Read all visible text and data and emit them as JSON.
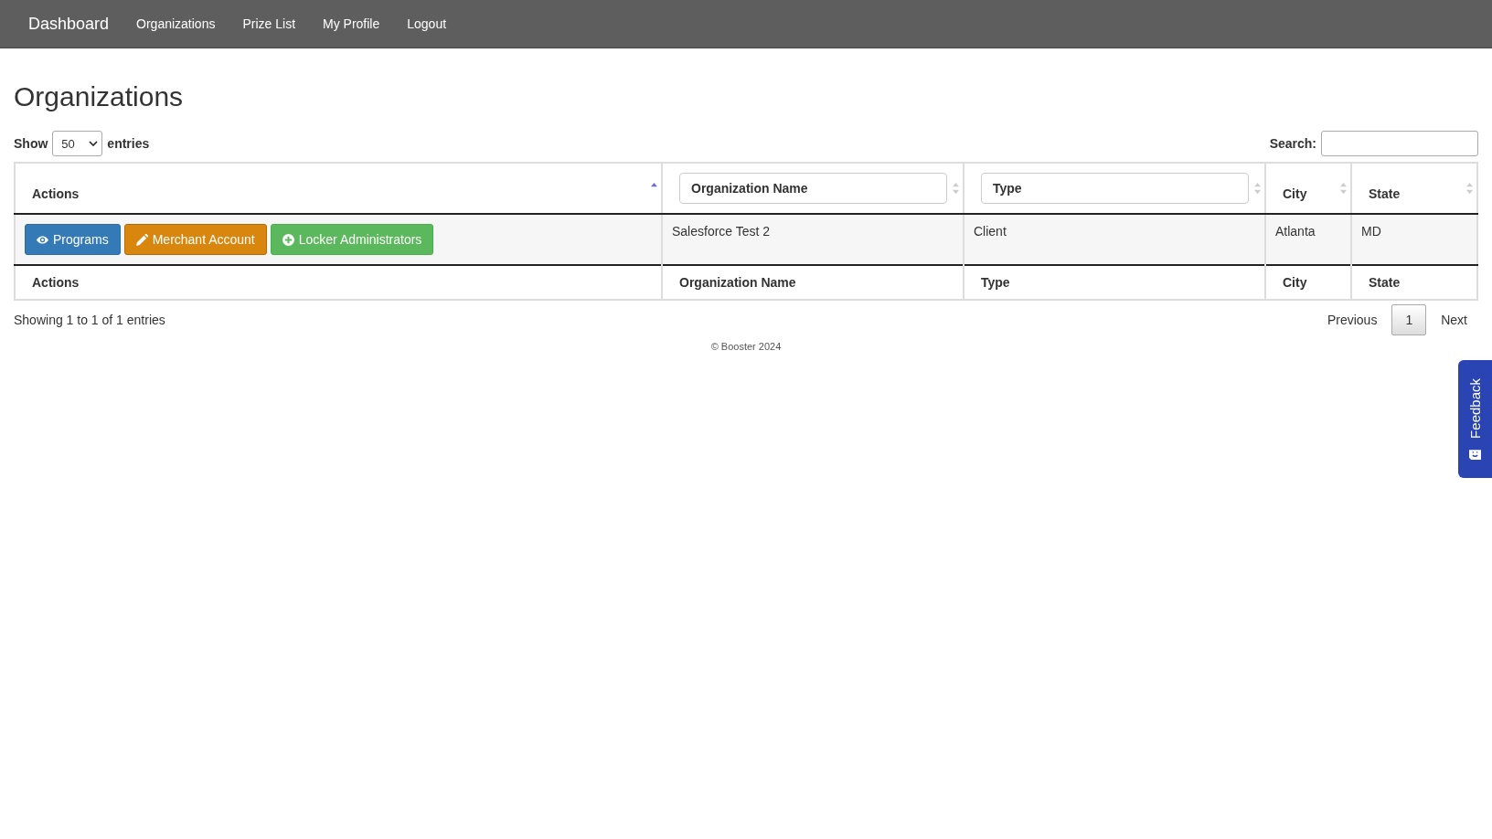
{
  "navbar": {
    "brand": "Dashboard",
    "links": [
      {
        "label": "Organizations"
      },
      {
        "label": "Prize List"
      },
      {
        "label": "My Profile"
      },
      {
        "label": "Logout"
      }
    ]
  },
  "page_title": "Organizations",
  "length_menu": {
    "label_before": "Show",
    "value": "50",
    "label_after": "entries"
  },
  "search": {
    "label": "Search:"
  },
  "table": {
    "columns": [
      {
        "label": "Actions",
        "kind": "text",
        "sorted": true
      },
      {
        "placeholder": "Organization Name",
        "kind": "filter",
        "sorted": false
      },
      {
        "placeholder": "Type",
        "kind": "filter",
        "sorted": false
      },
      {
        "label": "City",
        "kind": "text",
        "sorted": false
      },
      {
        "label": "State",
        "kind": "text",
        "sorted": false
      }
    ],
    "rows": [
      {
        "cells": [
          {
            "kind": "buttons",
            "buttons": [
              {
                "label": "Programs",
                "kind": "view"
              },
              {
                "label": "Merchant Account",
                "kind": "edit"
              },
              {
                "label": "Locker Administrators",
                "kind": "add"
              }
            ]
          },
          {
            "kind": "text",
            "text": "Salesforce Test 2"
          },
          {
            "kind": "text",
            "text": "Client"
          },
          {
            "kind": "text",
            "text": "Atlanta"
          },
          {
            "kind": "text",
            "text": "MD"
          }
        ]
      }
    ],
    "footer": [
      "Actions",
      "Organization Name",
      "Type",
      "City",
      "State"
    ]
  },
  "info": "Showing 1 to 1 of 1 entries",
  "pagination": {
    "previous": "Previous",
    "pages": [
      {
        "label": "1",
        "selected": true
      }
    ],
    "next": "Next"
  },
  "copyright": "© Booster 2024",
  "feedback": {
    "label": "Feedback"
  }
}
